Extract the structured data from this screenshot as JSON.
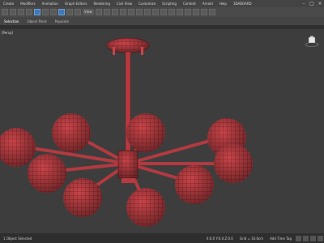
{
  "menu": [
    "Create",
    "Modifiers",
    "Animation",
    "Graph Editors",
    "Rendering",
    "Civil View",
    "Customize",
    "Scripting",
    "Content",
    "Arnold",
    "Help",
    "3DABOARD"
  ],
  "toolbar": {
    "view_dropdown": "View"
  },
  "ribbon": {
    "tabs": [
      "Selection",
      "Object Paint",
      "Populate"
    ]
  },
  "viewport": {
    "label": "[Persp]"
  },
  "status": {
    "left": "1 Object Selected",
    "coords": "X:0.0  Y:0.0  Z:0.0",
    "grid": "Grid = 10.0cm",
    "addtag": "Add Time Tag"
  },
  "colors": {
    "mesh": "#c8454a",
    "wire": "#6a1216",
    "background": "#3d3d3d"
  }
}
